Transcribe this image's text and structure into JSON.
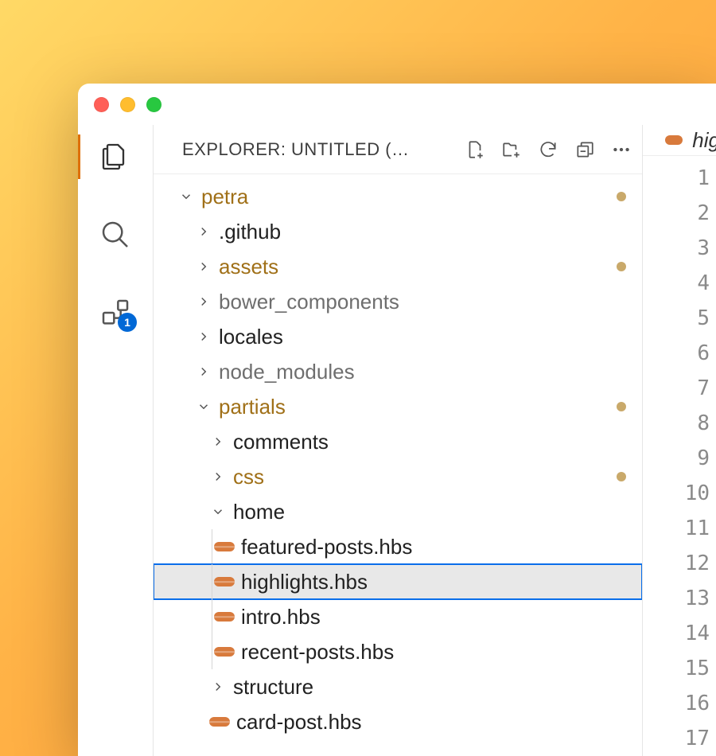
{
  "window": {
    "explorer_title": "EXPLORER: UNTITLED (…",
    "open_tab_label": "hig"
  },
  "activity_bar": {
    "items": [
      {
        "name": "explorer",
        "active": true
      },
      {
        "name": "search",
        "active": false
      },
      {
        "name": "source-control",
        "active": false,
        "badge": "1"
      }
    ]
  },
  "header_actions": [
    "new-file",
    "new-folder",
    "refresh",
    "collapse-all",
    "more"
  ],
  "tree": [
    {
      "label": "petra",
      "indent": 0,
      "type": "folder",
      "expanded": true,
      "modified": true,
      "dot": true
    },
    {
      "label": ".github",
      "indent": 1,
      "type": "folder",
      "expanded": false
    },
    {
      "label": "assets",
      "indent": 1,
      "type": "folder",
      "expanded": false,
      "modified": true,
      "dot": true
    },
    {
      "label": "bower_components",
      "indent": 1,
      "type": "folder",
      "expanded": false,
      "muted": true
    },
    {
      "label": "locales",
      "indent": 1,
      "type": "folder",
      "expanded": false
    },
    {
      "label": "node_modules",
      "indent": 1,
      "type": "folder",
      "expanded": false,
      "muted": true
    },
    {
      "label": "partials",
      "indent": 1,
      "type": "folder",
      "expanded": true,
      "modified": true,
      "dot": true
    },
    {
      "label": "comments",
      "indent": 2,
      "type": "folder",
      "expanded": false
    },
    {
      "label": "css",
      "indent": 2,
      "type": "folder",
      "expanded": false,
      "modified": true,
      "dot": true
    },
    {
      "label": "home",
      "indent": 2,
      "type": "folder",
      "expanded": true
    },
    {
      "label": "featured-posts.hbs",
      "indent": 3,
      "type": "file",
      "guide": true
    },
    {
      "label": "highlights.hbs",
      "indent": 3,
      "type": "file",
      "selected": true,
      "guide": true
    },
    {
      "label": "intro.hbs",
      "indent": 3,
      "type": "file",
      "guide": true
    },
    {
      "label": "recent-posts.hbs",
      "indent": 3,
      "type": "file",
      "guide": true
    },
    {
      "label": "structure",
      "indent": 2,
      "type": "folder",
      "expanded": false
    },
    {
      "label": "card-post.hbs",
      "indent": 2,
      "type": "file"
    }
  ],
  "line_numbers": [
    "1",
    "2",
    "3",
    "4",
    "5",
    "6",
    "7",
    "8",
    "9",
    "10",
    "11",
    "12",
    "13",
    "14",
    "15",
    "16",
    "17"
  ],
  "colors": {
    "accent": "#de7009",
    "modified": "#a07018",
    "selection_border": "#0a6eea",
    "badge": "#0068d6"
  }
}
